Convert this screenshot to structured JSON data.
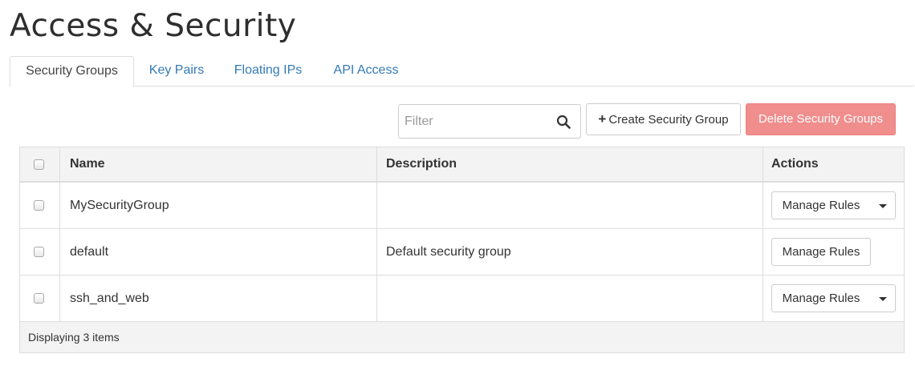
{
  "page": {
    "title": "Access & Security"
  },
  "tabs": [
    {
      "label": "Security Groups",
      "active": true
    },
    {
      "label": "Key Pairs",
      "active": false
    },
    {
      "label": "Floating IPs",
      "active": false
    },
    {
      "label": "API Access",
      "active": false
    }
  ],
  "toolbar": {
    "filter_placeholder": "Filter",
    "filter_value": "",
    "create_label": "Create Security Group",
    "delete_label": "Delete Security Groups"
  },
  "table": {
    "headers": {
      "name": "Name",
      "description": "Description",
      "actions": "Actions"
    },
    "rows": [
      {
        "name": "MySecurityGroup",
        "description": "",
        "action": "Manage Rules",
        "has_dropdown": true
      },
      {
        "name": "default",
        "description": "Default security group",
        "action": "Manage Rules",
        "has_dropdown": false
      },
      {
        "name": "ssh_and_web",
        "description": "",
        "action": "Manage Rules",
        "has_dropdown": true
      }
    ],
    "footer": "Displaying 3 items"
  },
  "colors": {
    "link": "#337ab7",
    "danger_disabled": "#f08d8d",
    "header_bg": "#f3f3f3"
  },
  "icons": {
    "search": "search-icon",
    "plus": "plus-icon",
    "dropdown": "caret-down-icon"
  }
}
